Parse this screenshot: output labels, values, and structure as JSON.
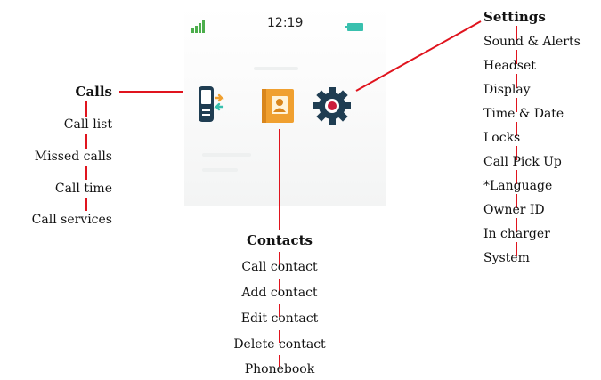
{
  "status_bar": {
    "time": "12:19"
  },
  "colors": {
    "connector": "#e0141e",
    "signal": "#4cae4c",
    "battery": "#39c0ae",
    "contacts_book": "#f0a030",
    "settings_gear": "#1f3d52",
    "settings_center": "#cc1c3c",
    "phone_body": "#1f3d52"
  },
  "icons": {
    "calls": "phone-swap-icon",
    "contacts": "contacts-book-icon",
    "settings": "gear-icon"
  },
  "calls": {
    "title": "Calls",
    "items": [
      "Call list",
      "Missed calls",
      "Call time",
      "Call services"
    ]
  },
  "contacts": {
    "title": "Contacts",
    "items": [
      "Call contact",
      "Add contact",
      "Edit contact",
      "Delete contact",
      "Phonebook"
    ]
  },
  "settings": {
    "title": "Settings",
    "items": [
      "Sound & Alerts",
      "Headset",
      "Display",
      "Time & Date",
      "Locks",
      "Call Pick Up",
      "*Language",
      "Owner ID",
      "In charger",
      "System"
    ]
  }
}
